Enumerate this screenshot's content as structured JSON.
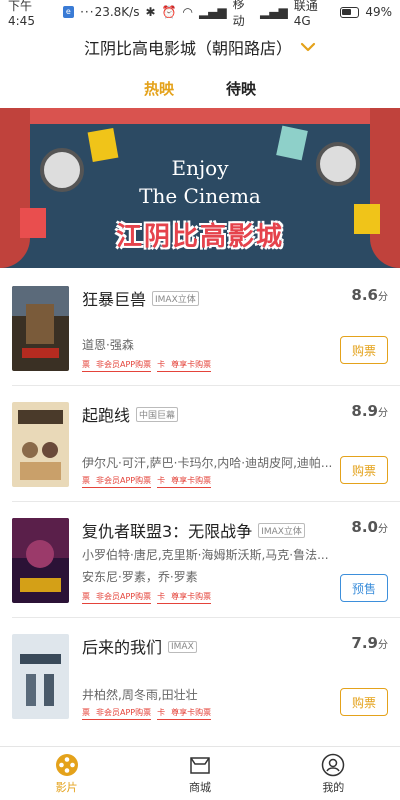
{
  "status": {
    "time": "下午4:45",
    "speed": "23.8K/s",
    "carrier1": "移动",
    "carrier2": "联通 4G",
    "battery": "49%"
  },
  "cinema": {
    "name": "江阴比高电影城（朝阳路店）"
  },
  "tabs": [
    {
      "label": "热映",
      "active": true
    },
    {
      "label": "待映",
      "active": false
    }
  ],
  "banner": {
    "line1": "Enjoy",
    "line2": "The Cinema",
    "title": "江阴比高影城"
  },
  "labels": {
    "ticket_k": "票",
    "ticket_v": "非会员APP购票",
    "card_k": "卡",
    "card_v": "尊享卡购票"
  },
  "movies": [
    {
      "title": "狂暴巨兽",
      "tag": "IMAX立体",
      "score": "8.6",
      "score_unit": "分",
      "cast": [
        "道恩·强森"
      ],
      "button": "购票",
      "button_color": "#e4a21b"
    },
    {
      "title": "起跑线",
      "tag": "中国巨幕",
      "score": "8.9",
      "score_unit": "分",
      "cast": [
        "伊尔凡·可汗,萨巴·卡玛尔,内哈·迪胡皮阿,迪帕..."
      ],
      "button": "购票",
      "button_color": "#e4a21b"
    },
    {
      "title": "复仇者联盟3：无限战争",
      "tag": "IMAX立体",
      "score": "8.0",
      "score_unit": "分",
      "cast": [
        "小罗伯特·唐尼,克里斯·海姆斯沃斯,马克·鲁法...",
        "安东尼·罗素，乔·罗素"
      ],
      "button": "预售",
      "button_color": "#3d8fdb"
    },
    {
      "title": "后来的我们",
      "tag": "IMAX",
      "score": "7.9",
      "score_unit": "分",
      "cast": [
        "井柏然,周冬雨,田壮壮"
      ],
      "button": "购票",
      "button_color": "#e4a21b"
    }
  ],
  "nav": [
    {
      "label": "影片",
      "icon": "film-reel-icon",
      "active": true
    },
    {
      "label": "商城",
      "icon": "shop-icon",
      "active": false
    },
    {
      "label": "我的",
      "icon": "user-icon",
      "active": false
    }
  ]
}
